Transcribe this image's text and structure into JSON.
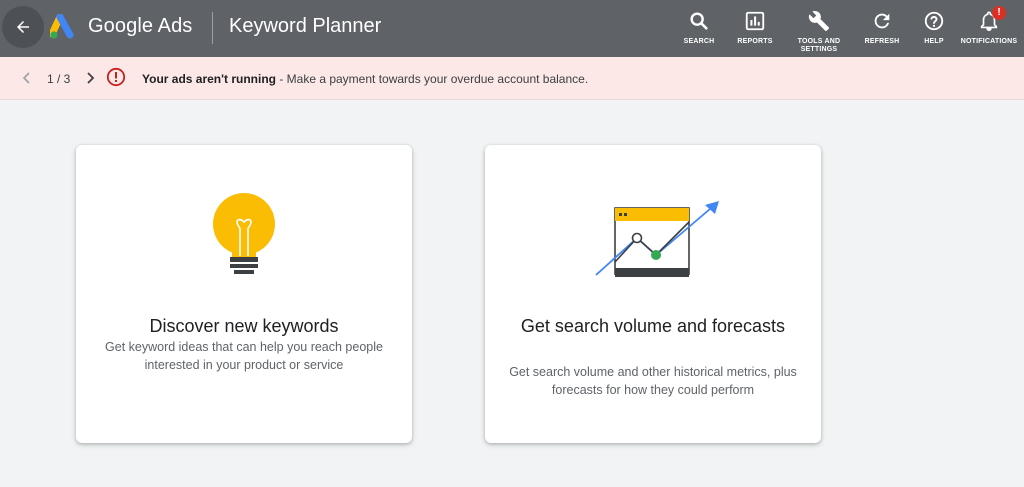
{
  "header": {
    "brand": "Google Ads",
    "page_title": "Keyword Planner",
    "tools": {
      "search": "SEARCH",
      "reports": "REPORTS",
      "tools_settings": "TOOLS AND SETTINGS",
      "refresh": "REFRESH",
      "help": "HELP",
      "notifications": "NOTIFICATIONS"
    },
    "notification_badge": "!"
  },
  "alert": {
    "pager": "1 / 3",
    "title": "Your ads aren't running",
    "message": " - Make a payment towards your overdue account balance."
  },
  "cards": [
    {
      "title": "Discover new keywords",
      "description": "Get keyword ideas that can help you reach people interested in your product or service"
    },
    {
      "title": "Get search volume and forecasts",
      "description": "Get search volume and other historical metrics, plus forecasts for how they could perform"
    }
  ],
  "colors": {
    "header_bg": "#5f6368",
    "alert_bg": "#fce8e6",
    "alert_icon": "#c5221f",
    "page_bg": "#f1f3f4",
    "bulb_yellow": "#fbbc04",
    "arrow_blue": "#4285f4",
    "point_green": "#34a853"
  }
}
